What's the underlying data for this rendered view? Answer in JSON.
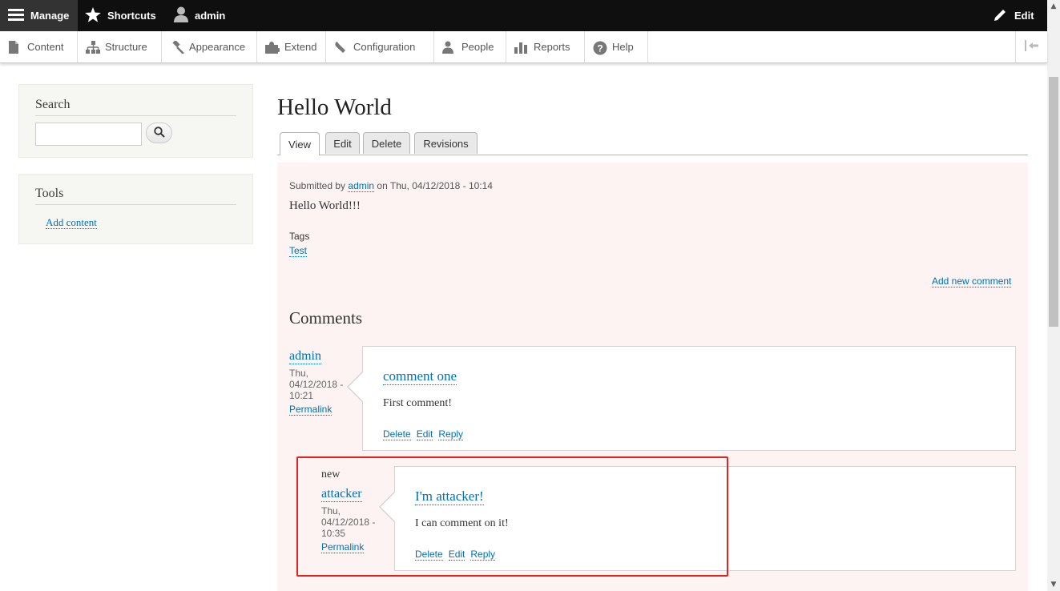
{
  "toolbar": {
    "manage": "Manage",
    "shortcuts": "Shortcuts",
    "user": "admin",
    "edit": "Edit"
  },
  "tray": {
    "items": [
      {
        "label": "Content",
        "icon": "file-icon"
      },
      {
        "label": "Structure",
        "icon": "sitemap-icon"
      },
      {
        "label": "Appearance",
        "icon": "gavel-icon"
      },
      {
        "label": "Extend",
        "icon": "puzzle-icon"
      },
      {
        "label": "Configuration",
        "icon": "wrench-icon"
      },
      {
        "label": "People",
        "icon": "people-icon"
      },
      {
        "label": "Reports",
        "icon": "bar-chart-icon"
      },
      {
        "label": "Help",
        "icon": "help-icon"
      }
    ]
  },
  "sidebar": {
    "search_title": "Search",
    "tools_title": "Tools",
    "add_content": "Add content"
  },
  "main": {
    "title": "Hello World",
    "tabs": [
      "View",
      "Edit",
      "Delete",
      "Revisions"
    ],
    "meta_prefix": "Submitted by",
    "meta_author": "admin",
    "meta_suffix": "on Thu, 04/12/2018 - 10:14",
    "body": "Hello World!!!",
    "tags_label": "Tags",
    "tag": "Test",
    "add_comment": "Add new comment",
    "comments_heading": "Comments"
  },
  "comments": [
    {
      "author": "admin",
      "date": "Thu, 04/12/2018 - 10:21",
      "permalink": "Permalink",
      "title": "comment one",
      "body": "First comment!",
      "links": [
        "Delete",
        "Edit",
        "Reply"
      ]
    },
    {
      "new_marker": "new",
      "author": "attacker",
      "date": "Thu, 04/12/2018 - 10:35",
      "permalink": "Permalink",
      "title": "I'm attacker!",
      "body": "I can comment on it!",
      "links": [
        "Delete",
        "Edit",
        "Reply"
      ]
    }
  ],
  "colors": {
    "link": "#0071b3",
    "highlight": "#e3231c",
    "node_bg": "#fdf3f3"
  }
}
